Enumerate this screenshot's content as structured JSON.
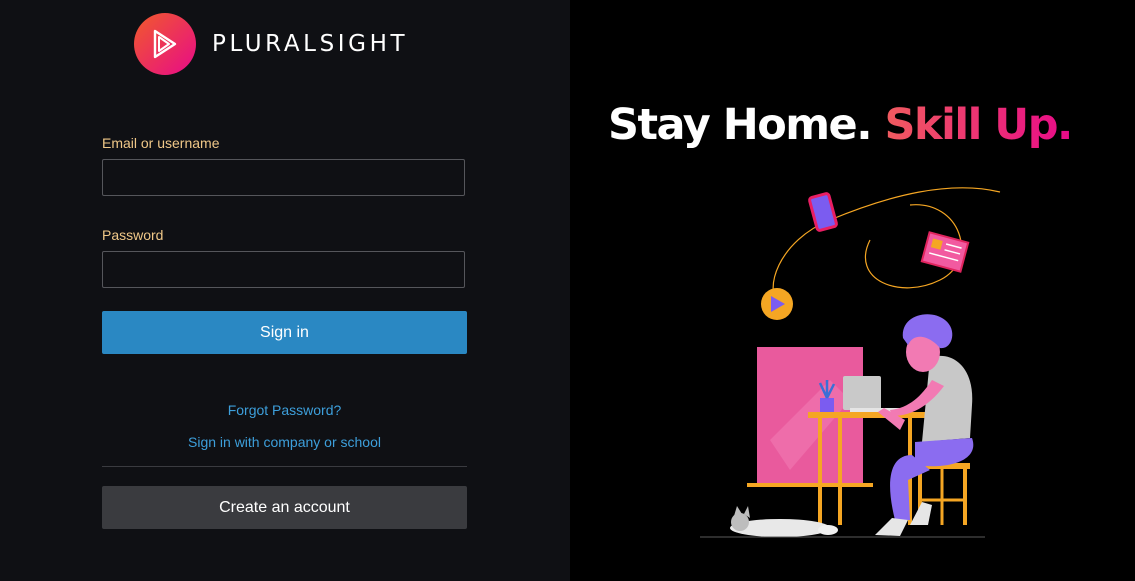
{
  "brand": {
    "name": "PLURALSIGHT",
    "colors": {
      "accent_orange": "#f15b2a",
      "accent_pink": "#e80a89"
    }
  },
  "form": {
    "email_label": "Email or username",
    "email_value": "",
    "password_label": "Password",
    "password_value": "",
    "signin_label": "Sign in",
    "forgot_link": "Forgot Password?",
    "company_link": "Sign in with company or school",
    "create_label": "Create an account"
  },
  "promo": {
    "headline_white": "Stay Home.",
    "headline_pink": "Skill Up."
  },
  "colors": {
    "left_bg": "#0f1014",
    "primary_button": "#2a88c3",
    "secondary_button": "#3a3b3f",
    "link": "#3d9fdb",
    "label": "#f0c888"
  }
}
